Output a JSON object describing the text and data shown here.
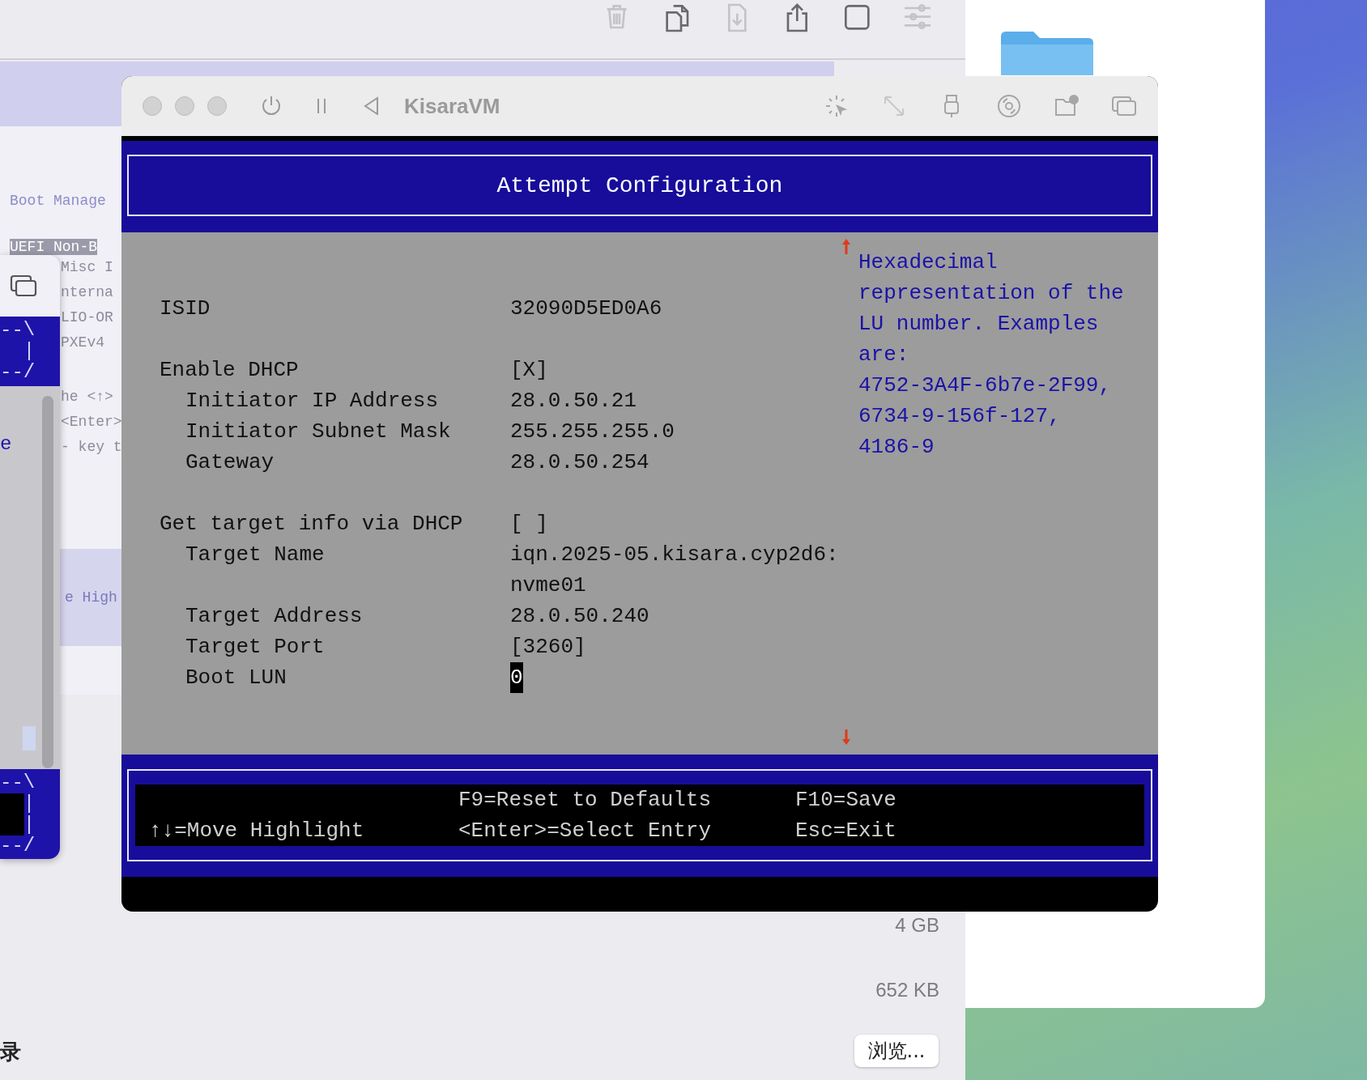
{
  "settings_window": {
    "toolbar": [
      {
        "kind": "trash",
        "disabled": true
      },
      {
        "kind": "copy",
        "disabled": false
      },
      {
        "kind": "download",
        "disabled": true
      },
      {
        "kind": "share",
        "disabled": false
      },
      {
        "kind": "square",
        "disabled": false
      },
      {
        "kind": "sliders",
        "disabled": true
      }
    ],
    "sizes": [
      "4 GB",
      "652 KB"
    ],
    "browse_button": "浏览...",
    "cut_label": "录"
  },
  "background_vm": {
    "title": "Boot Manage",
    "highlighted_entry": "UEFI Non-B",
    "entries": [
      "Misc I",
      "nterna",
      "LIO-OR",
      "PXEv4"
    ],
    "hints": [
      "he <↑>",
      "<Enter>",
      "- key t"
    ],
    "footer": "e High"
  },
  "side_vm": {
    "frame_top": [
      "--\\",
      "|",
      "--/"
    ],
    "text": "e",
    "frame_bottom": [
      "--\\",
      "|",
      "|",
      "--/"
    ]
  },
  "vm_window": {
    "title": "KisaraVM",
    "page_title": "Attempt Configuration",
    "groups": [
      {
        "label": "ISID",
        "value": "32090D5ED0A6",
        "selected": false
      },
      {
        "label": "Enable DHCP",
        "value": "[X]",
        "selected": false,
        "children": [
          {
            "label": "Initiator IP Address",
            "value": "28.0.50.21",
            "selected": false
          },
          {
            "label": "Initiator Subnet Mask",
            "value": "255.255.255.0",
            "selected": false
          },
          {
            "label": "Gateway",
            "value": "28.0.50.254",
            "selected": false
          }
        ]
      },
      {
        "label": "Get target info via DHCP",
        "value": "[ ]",
        "selected": false,
        "children": [
          {
            "label": "Target Name",
            "value": "iqn.2025-05.kisara.cyp2d6:",
            "value_continued": "nvme01",
            "selected": false
          },
          {
            "label": "Target Address",
            "value": "28.0.50.240",
            "selected": false
          },
          {
            "label": "Target Port",
            "value": "[3260]",
            "selected": false
          },
          {
            "label": "Boot LUN",
            "value": "0",
            "selected": true
          }
        ]
      }
    ],
    "help_lines": [
      "Hexadecimal",
      "representation of the",
      "LU number. Examples",
      "are:",
      "4752-3A4F-6b7e-2F99,",
      "6734-9-156f-127,",
      "4186-9"
    ],
    "footer_columns": [
      [
        "↑↓=Move Highlight"
      ],
      [
        "F9=Reset to Defaults",
        "<Enter>=Select Entry"
      ],
      [
        "F10=Save",
        "Esc=Exit"
      ]
    ]
  }
}
